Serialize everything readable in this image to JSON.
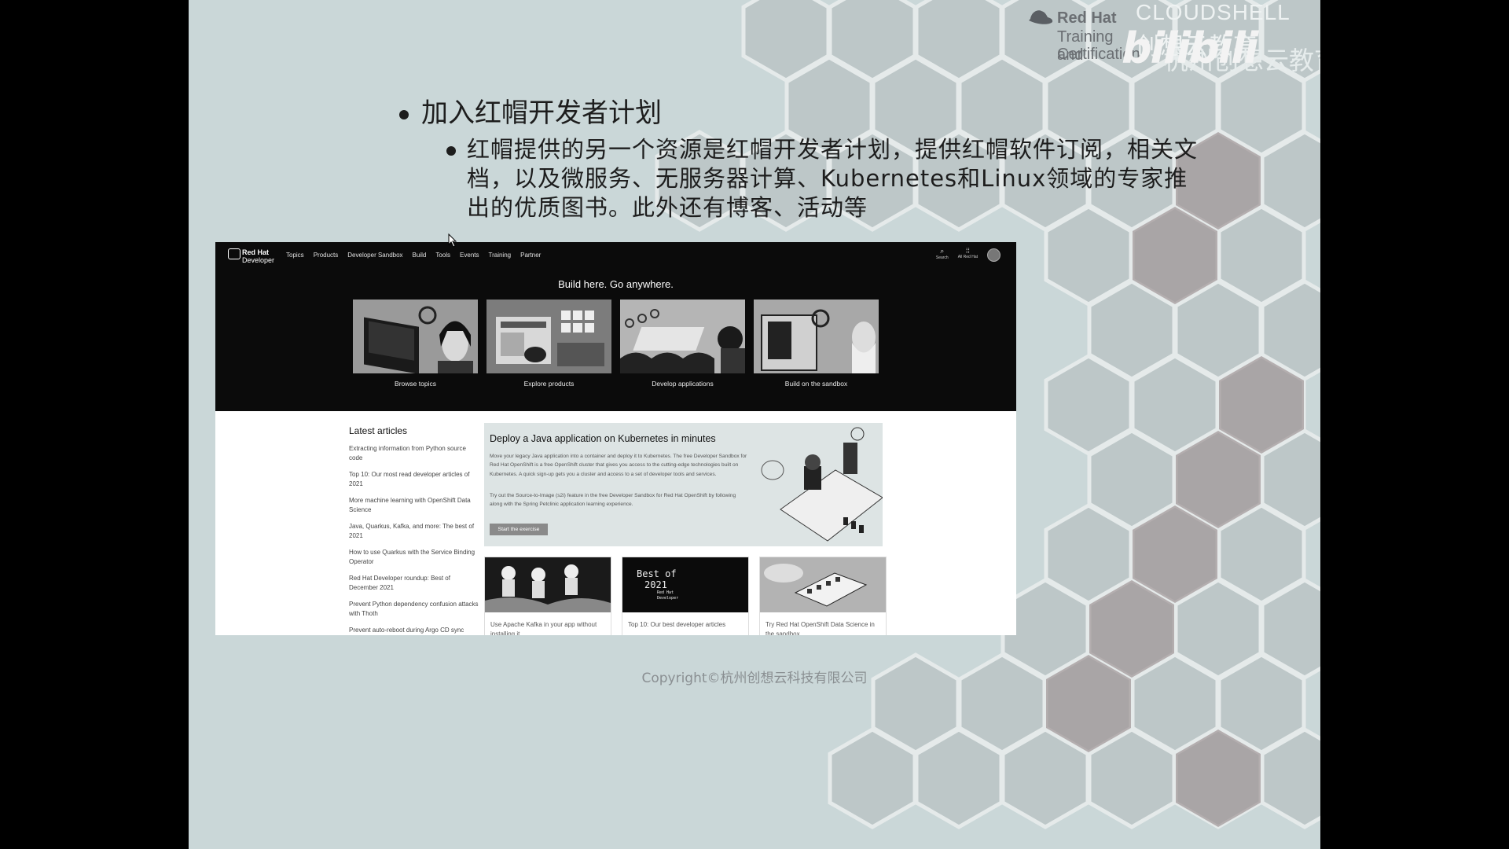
{
  "branding": {
    "redhat_name": "Red Hat",
    "redhat_line1": "Training and",
    "redhat_line2": "Certification",
    "cloudshell": "CLOUDSHELL",
    "cloudshell_cn": "创想云教育",
    "hangzhou": "杭州创想云教育",
    "bilibili": "bilibili"
  },
  "slide": {
    "bullet1": "加入红帽开发者计划",
    "bullet2": "红帽提供的另一个资源是红帽开发者计划，提供红帽软件订阅，相关文档，以及微服务、无服务器计算、Kubernetes和Linux领域的专家推出的优质图书。此外还有博客、活动等",
    "copyright": "Copyright©杭州创想云科技有限公司"
  },
  "site": {
    "logo_line1": "Red Hat",
    "logo_line2": "Developer",
    "nav": [
      "Topics",
      "Products",
      "Developer Sandbox",
      "Build",
      "Tools",
      "Events",
      "Training",
      "Partner"
    ],
    "search_label": "Search",
    "all_red_hat_label": "All Red Hat",
    "hero_title": "Build here. Go anywhere.",
    "tiles": [
      "Browse topics",
      "Explore products",
      "Develop applications",
      "Build on the sandbox"
    ],
    "latest_title": "Latest articles",
    "articles": [
      "Extracting information from Python source code",
      "Top 10: Our most read developer articles of 2021",
      "More machine learning with OpenShift Data Science",
      "Java, Quarkus, Kafka, and more: The best of 2021",
      "How to use Quarkus with the Service Binding Operator",
      "Red Hat Developer roundup: Best of December 2021",
      "Prevent Python dependency confusion attacks with Thoth",
      "Prevent auto-reboot during Argo CD sync"
    ],
    "feature": {
      "title": "Deploy a Java application on Kubernetes in minutes",
      "para1": "Move your legacy Java application into a container and deploy it to Kubernetes. The free Developer Sandbox for Red Hat OpenShift is a free OpenShift cluster that gives you access to the cutting-edge technologies built on Kubernetes. A quick sign-up gets you a cluster and access to a set of developer tools and services.",
      "para2": "Try out the Source-to-Image (s2i) feature in the free Developer Sandbox for Red Hat OpenShift by following along with the Spring Petclinic application learning experience.",
      "button": "Start the exercise"
    },
    "cards": [
      "Use Apache Kafka in your app without installing it",
      "Top 10: Our best developer articles",
      "Try Red Hat OpenShift Data Science in the sandbox"
    ],
    "best_of_line1": "Best of",
    "best_of_line2": "2021",
    "best_of_brand": "Red Hat Developer"
  }
}
